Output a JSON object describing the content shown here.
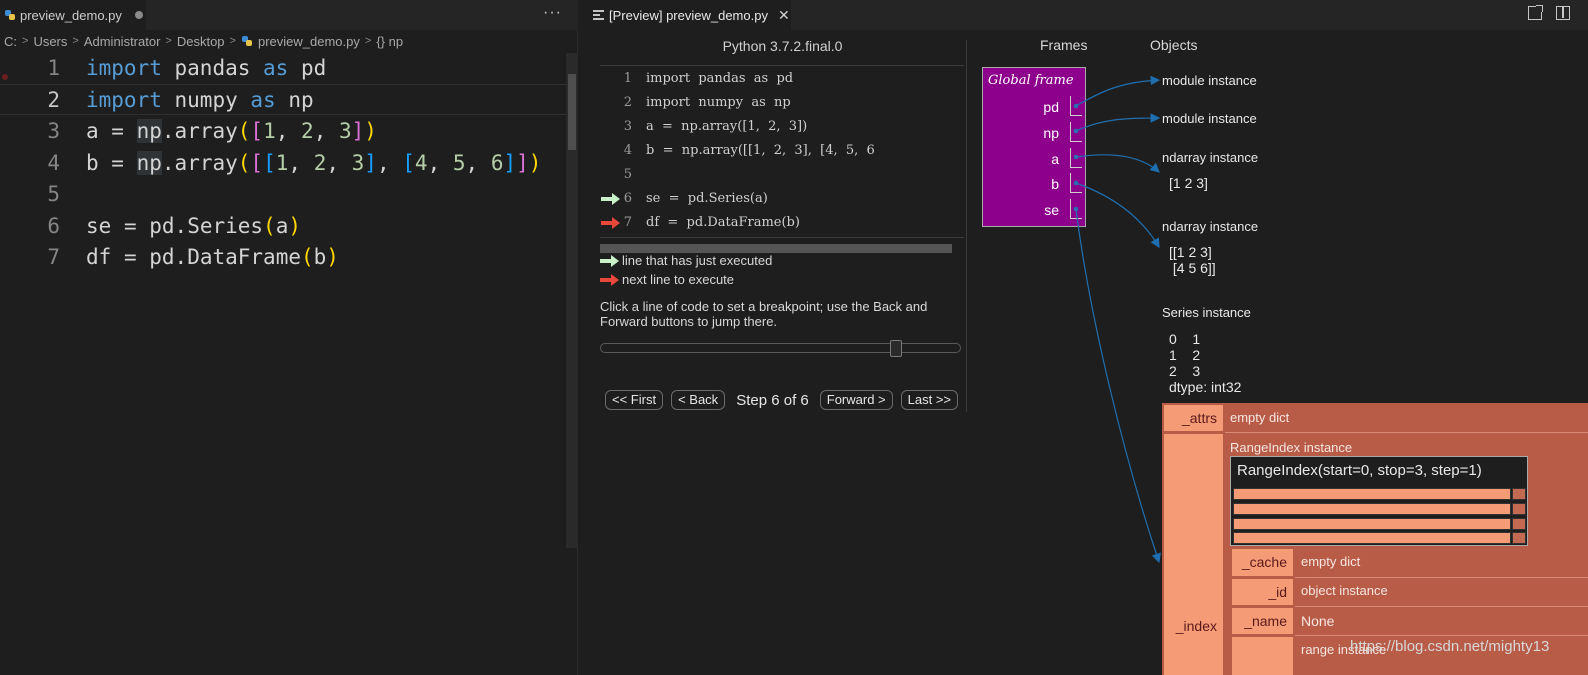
{
  "left_editor": {
    "tab_label": "preview_demo.py",
    "more_label": "···",
    "breadcrumb": [
      "C:",
      "Users",
      "Administrator",
      "Desktop",
      "preview_demo.py",
      "{} np"
    ],
    "lines": [
      {
        "n": "1"
      },
      {
        "n": "2"
      },
      {
        "n": "3"
      },
      {
        "n": "4"
      },
      {
        "n": "5"
      },
      {
        "n": "6"
      },
      {
        "n": "7"
      }
    ],
    "tokens": {
      "import": "import",
      "as": "as",
      "pandas": "pandas",
      "numpy": "numpy",
      "pd": "pd",
      "np": "np",
      "a": "a",
      "b": "b",
      "se": "se",
      "df": "df",
      "eq": " = ",
      "array": "array",
      "series": "Series",
      "dataframe": "DataFrame",
      "dot": ".",
      "comma": ", ",
      "lparen": "(",
      "rparen": ")",
      "lbrack": "[",
      "rbrack": "]",
      "one": "1",
      "two": "2",
      "three": "3",
      "four": "4",
      "five": "5",
      "six": "6"
    }
  },
  "preview": {
    "tab_label": "[Preview] preview_demo.py",
    "close_label": "✕",
    "python_version": "Python 3.7.2.final.0",
    "code_lines": [
      {
        "n": "1",
        "text": "import  pandas  as  pd"
      },
      {
        "n": "2",
        "text": "import  numpy  as  np"
      },
      {
        "n": "3",
        "text": "a  =  np.array([1,  2,  3])"
      },
      {
        "n": "4",
        "text": "b  =  np.array([[1,  2,  3],  [4,  5,  6"
      },
      {
        "n": "5",
        "text": ""
      },
      {
        "n": "6",
        "text": "se  =  pd.Series(a)"
      },
      {
        "n": "7",
        "text": "df  =  pd.DataFrame(b)"
      }
    ],
    "legend_executed": "line that has just executed",
    "legend_next": "next line to execute",
    "breakpoint_help": "Click a line of code to set a breakpoint; use the Back and Forward buttons to jump there.",
    "nav": {
      "first": "<< First",
      "back": "< Back",
      "step": "Step 6 of 6",
      "forward": "Forward >",
      "last": "Last >>"
    },
    "slider_position": 0.83,
    "frames_header": "Frames",
    "objects_header": "Objects",
    "global_frame_title": "Global frame",
    "frame_vars": [
      "pd",
      "np",
      "a",
      "b",
      "se"
    ],
    "objects": {
      "pd_label": "module instance",
      "np_label": "module instance",
      "a_label": "ndarray instance",
      "a_value": "[1 2 3]",
      "b_label": "ndarray instance",
      "b_value": "[[1 2 3]\n [4 5 6]]",
      "se_label": "Series instance",
      "se_value": "0    1\n1    2\n2    3\ndtype: int32"
    },
    "dataframe": {
      "attrs_key": "_attrs",
      "attrs_val": "empty dict",
      "index_key": "_index",
      "rangeindex_label": "RangeIndex instance",
      "rangeindex_text": "RangeIndex(start=0, stop=3, step=1)",
      "cache_key": "_cache",
      "cache_val": "empty dict",
      "id_key": "_id",
      "id_val": "object instance",
      "name_key": "_name",
      "name_val": "None",
      "range_val": "range instance"
    },
    "watermark": "https://blog.csdn.net/mighty13"
  },
  "colors": {
    "frame_purple": "#8c008c",
    "pointer_blue": "#1f6fb0",
    "arrow_green": "#c9f2c9",
    "arrow_red": "#e8473c",
    "df_key": "#f59b75",
    "df_body": "#b85c48"
  }
}
